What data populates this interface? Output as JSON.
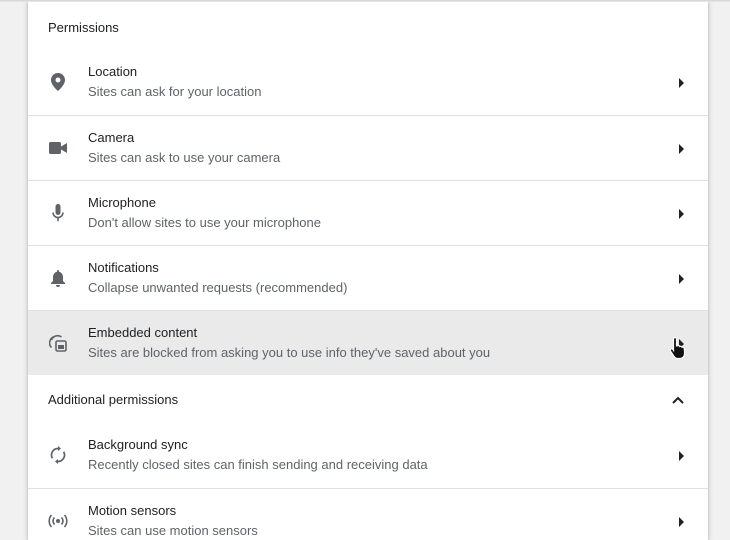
{
  "permissions": {
    "heading": "Permissions",
    "items": [
      {
        "title": "Location",
        "subtitle": "Sites can ask for your location",
        "icon": "location-pin-icon"
      },
      {
        "title": "Camera",
        "subtitle": "Sites can ask to use your camera",
        "icon": "camera-icon"
      },
      {
        "title": "Microphone",
        "subtitle": "Don't allow sites to use your microphone",
        "icon": "microphone-icon"
      },
      {
        "title": "Notifications",
        "subtitle": "Collapse unwanted requests (recommended)",
        "icon": "bell-icon"
      },
      {
        "title": "Embedded content",
        "subtitle": "Sites are blocked from asking you to use info they've saved about you",
        "icon": "embedded-content-icon"
      }
    ]
  },
  "additional": {
    "heading": "Additional permissions",
    "expanded": true,
    "items": [
      {
        "title": "Background sync",
        "subtitle": "Recently closed sites can finish sending and receiving data",
        "icon": "sync-icon"
      },
      {
        "title": "Motion sensors",
        "subtitle": "Sites can use motion sensors",
        "icon": "sensors-icon"
      }
    ]
  },
  "colors": {
    "text_primary": "#202124",
    "text_secondary": "#5f6368",
    "icon": "#5f6368",
    "hover_row": "#eaeaea",
    "divider": "#e0e0e0"
  }
}
